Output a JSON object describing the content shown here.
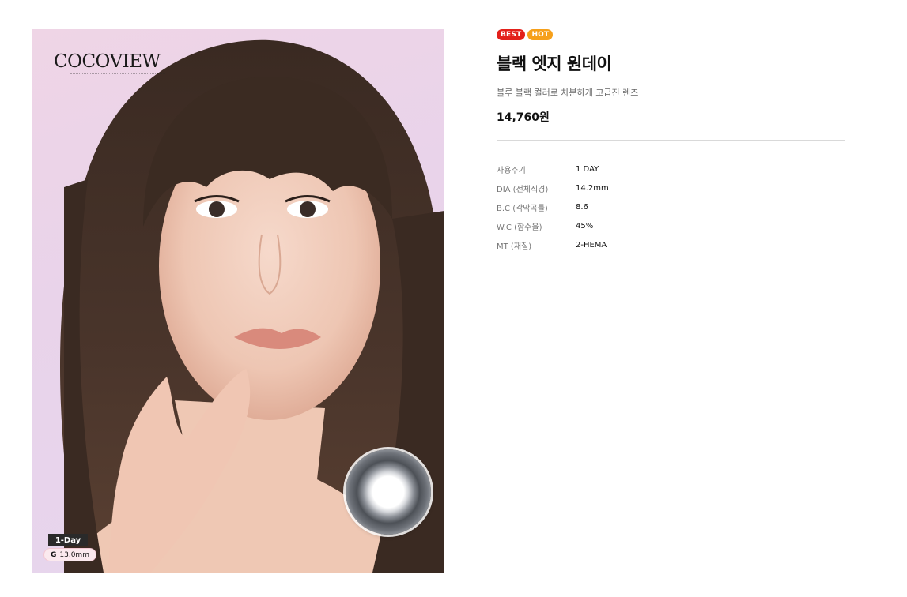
{
  "product_image": {
    "brand_logo": "COCOVIEW",
    "cycle_tag": "1-Day",
    "dia_tag_prefix": "G",
    "dia_tag_value": "13.0mm"
  },
  "product": {
    "badges": [
      "BEST",
      "HOT"
    ],
    "title": "블랙 엣지 원데이",
    "subtitle": "블루 블랙 컬러로 차분하게 고급진 렌즈",
    "price": "14,760원"
  },
  "specs": [
    {
      "label": "사용주기",
      "value": "1 DAY"
    },
    {
      "label": "DIA (전체직경)",
      "value": "14.2mm"
    },
    {
      "label": "B.C (각막곡률)",
      "value": "8.6"
    },
    {
      "label": "W.C (함수율)",
      "value": "45%"
    },
    {
      "label": "MT (재질)",
      "value": "2-HEMA"
    }
  ],
  "colors": {
    "best_badge": "#e3211b",
    "hot_badge": "#f6a01a",
    "background": "#ffffff"
  }
}
